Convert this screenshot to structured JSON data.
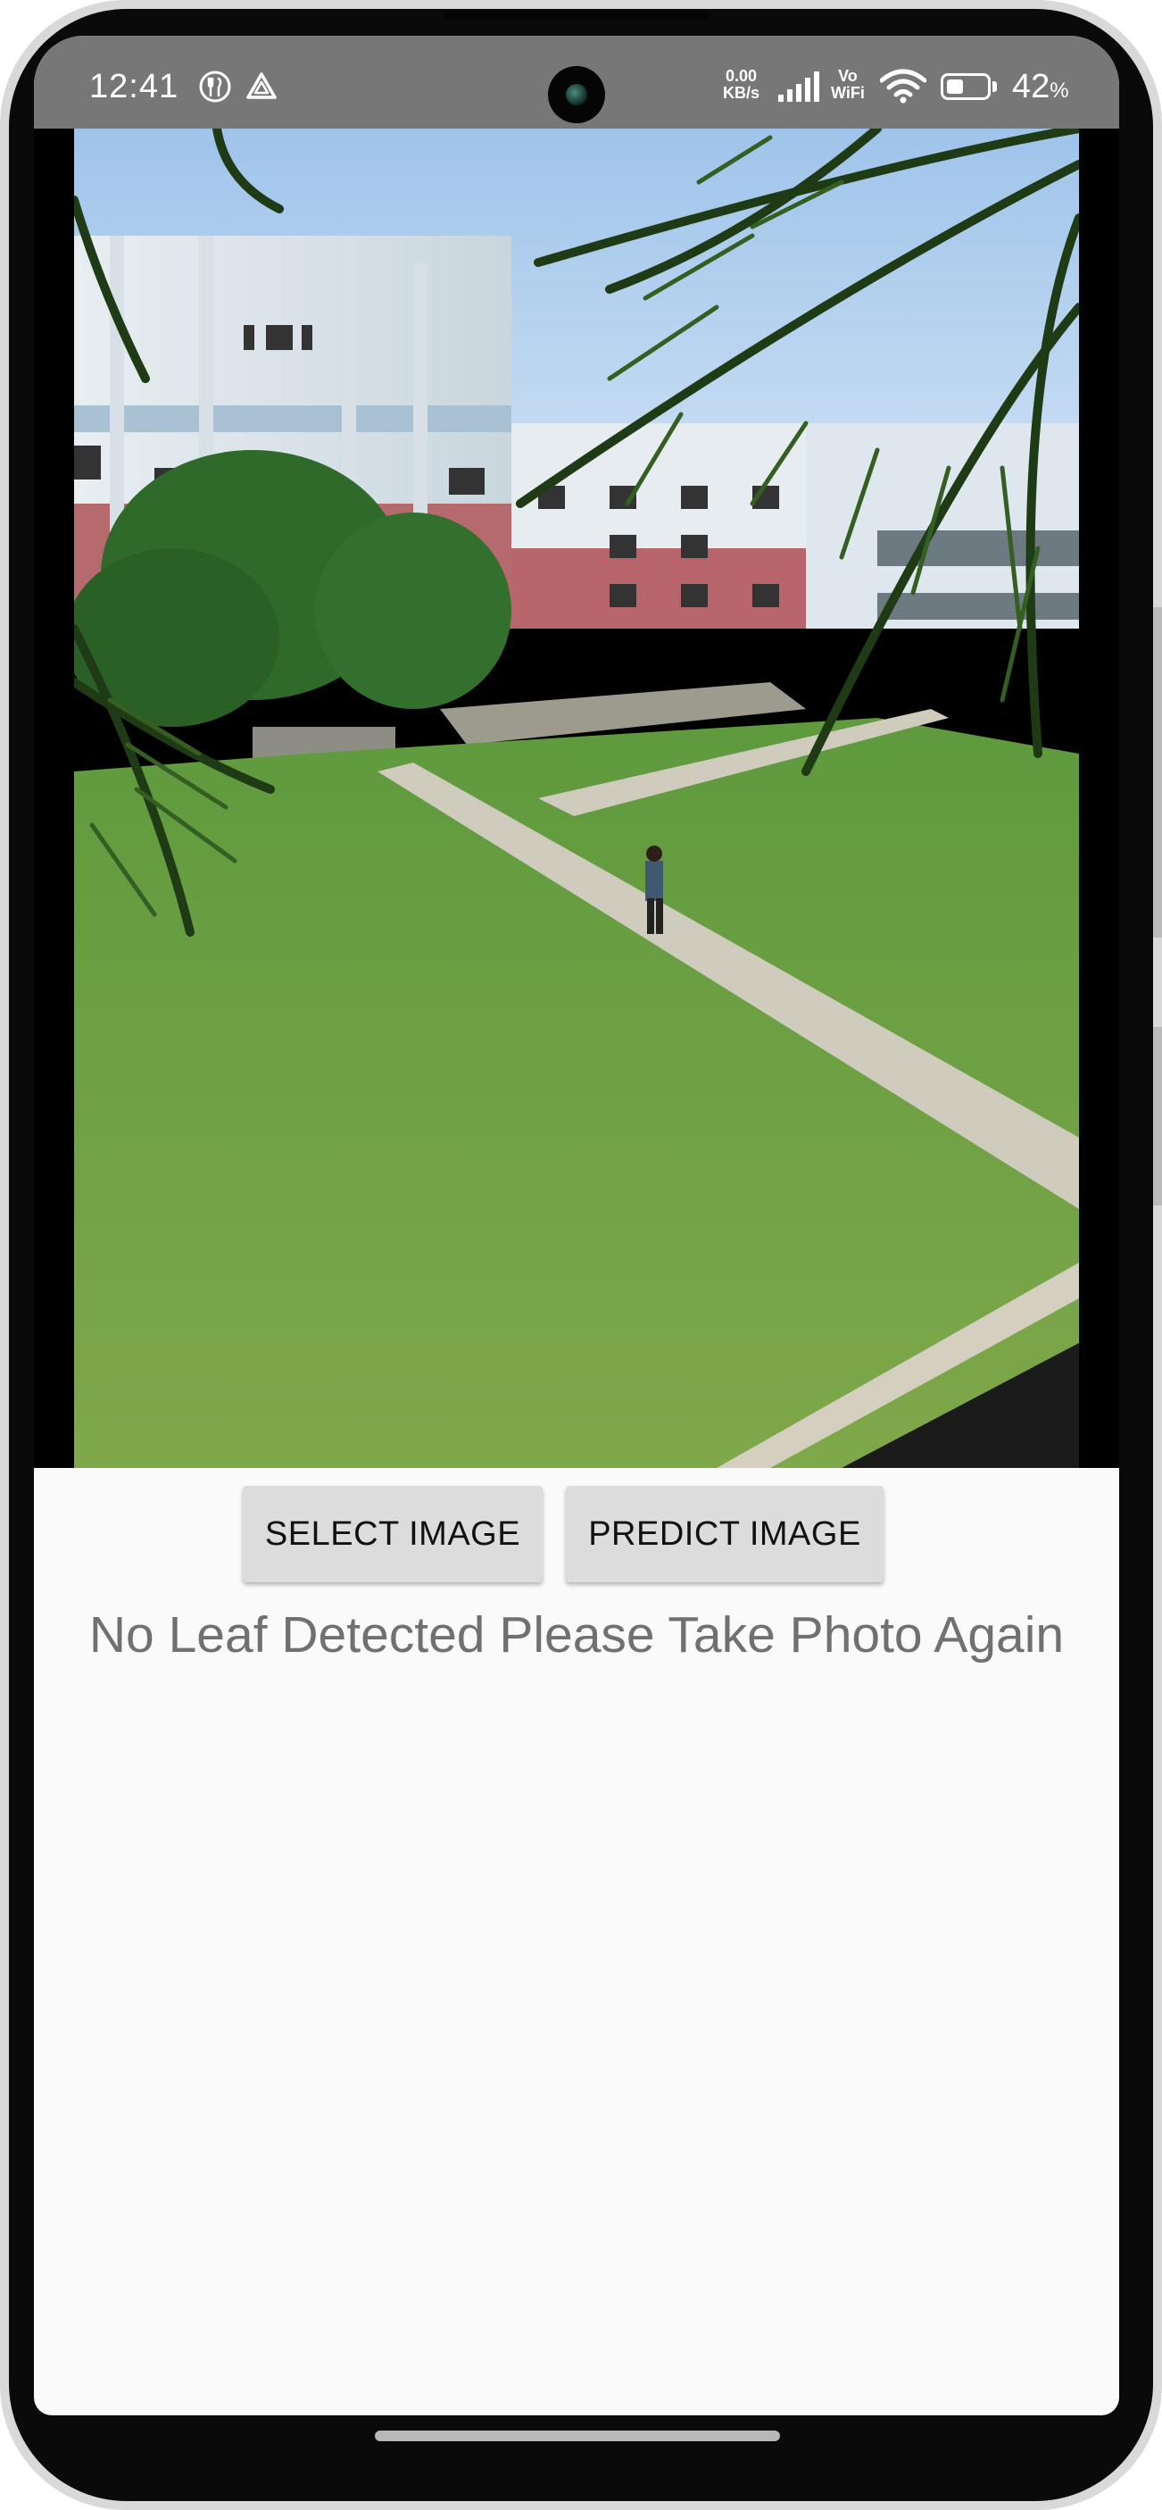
{
  "status_bar": {
    "time": "12:41",
    "net_speed_top": "0.00",
    "net_speed_bottom": "KB/s",
    "volte_top": "Vo",
    "volte_bottom": "WiFi",
    "battery_level": 0.42,
    "battery_number": "42",
    "battery_unit": "%",
    "icons": [
      "fork-knife-icon",
      "drive-icon",
      "signal-icon",
      "wifi-icon",
      "battery-icon"
    ]
  },
  "image_view": {
    "description_icon": "photo-image"
  },
  "actions": {
    "select_label": "SELECT IMAGE",
    "predict_label": "PREDICT IMAGE"
  },
  "result": {
    "message": "No Leaf Detected Please Take Photo Again"
  },
  "colors": {
    "status_bar_bg": "#777777",
    "button_bg": "#dcdcdc",
    "result_text": "#707070",
    "screen_bg": "#fafafa"
  }
}
